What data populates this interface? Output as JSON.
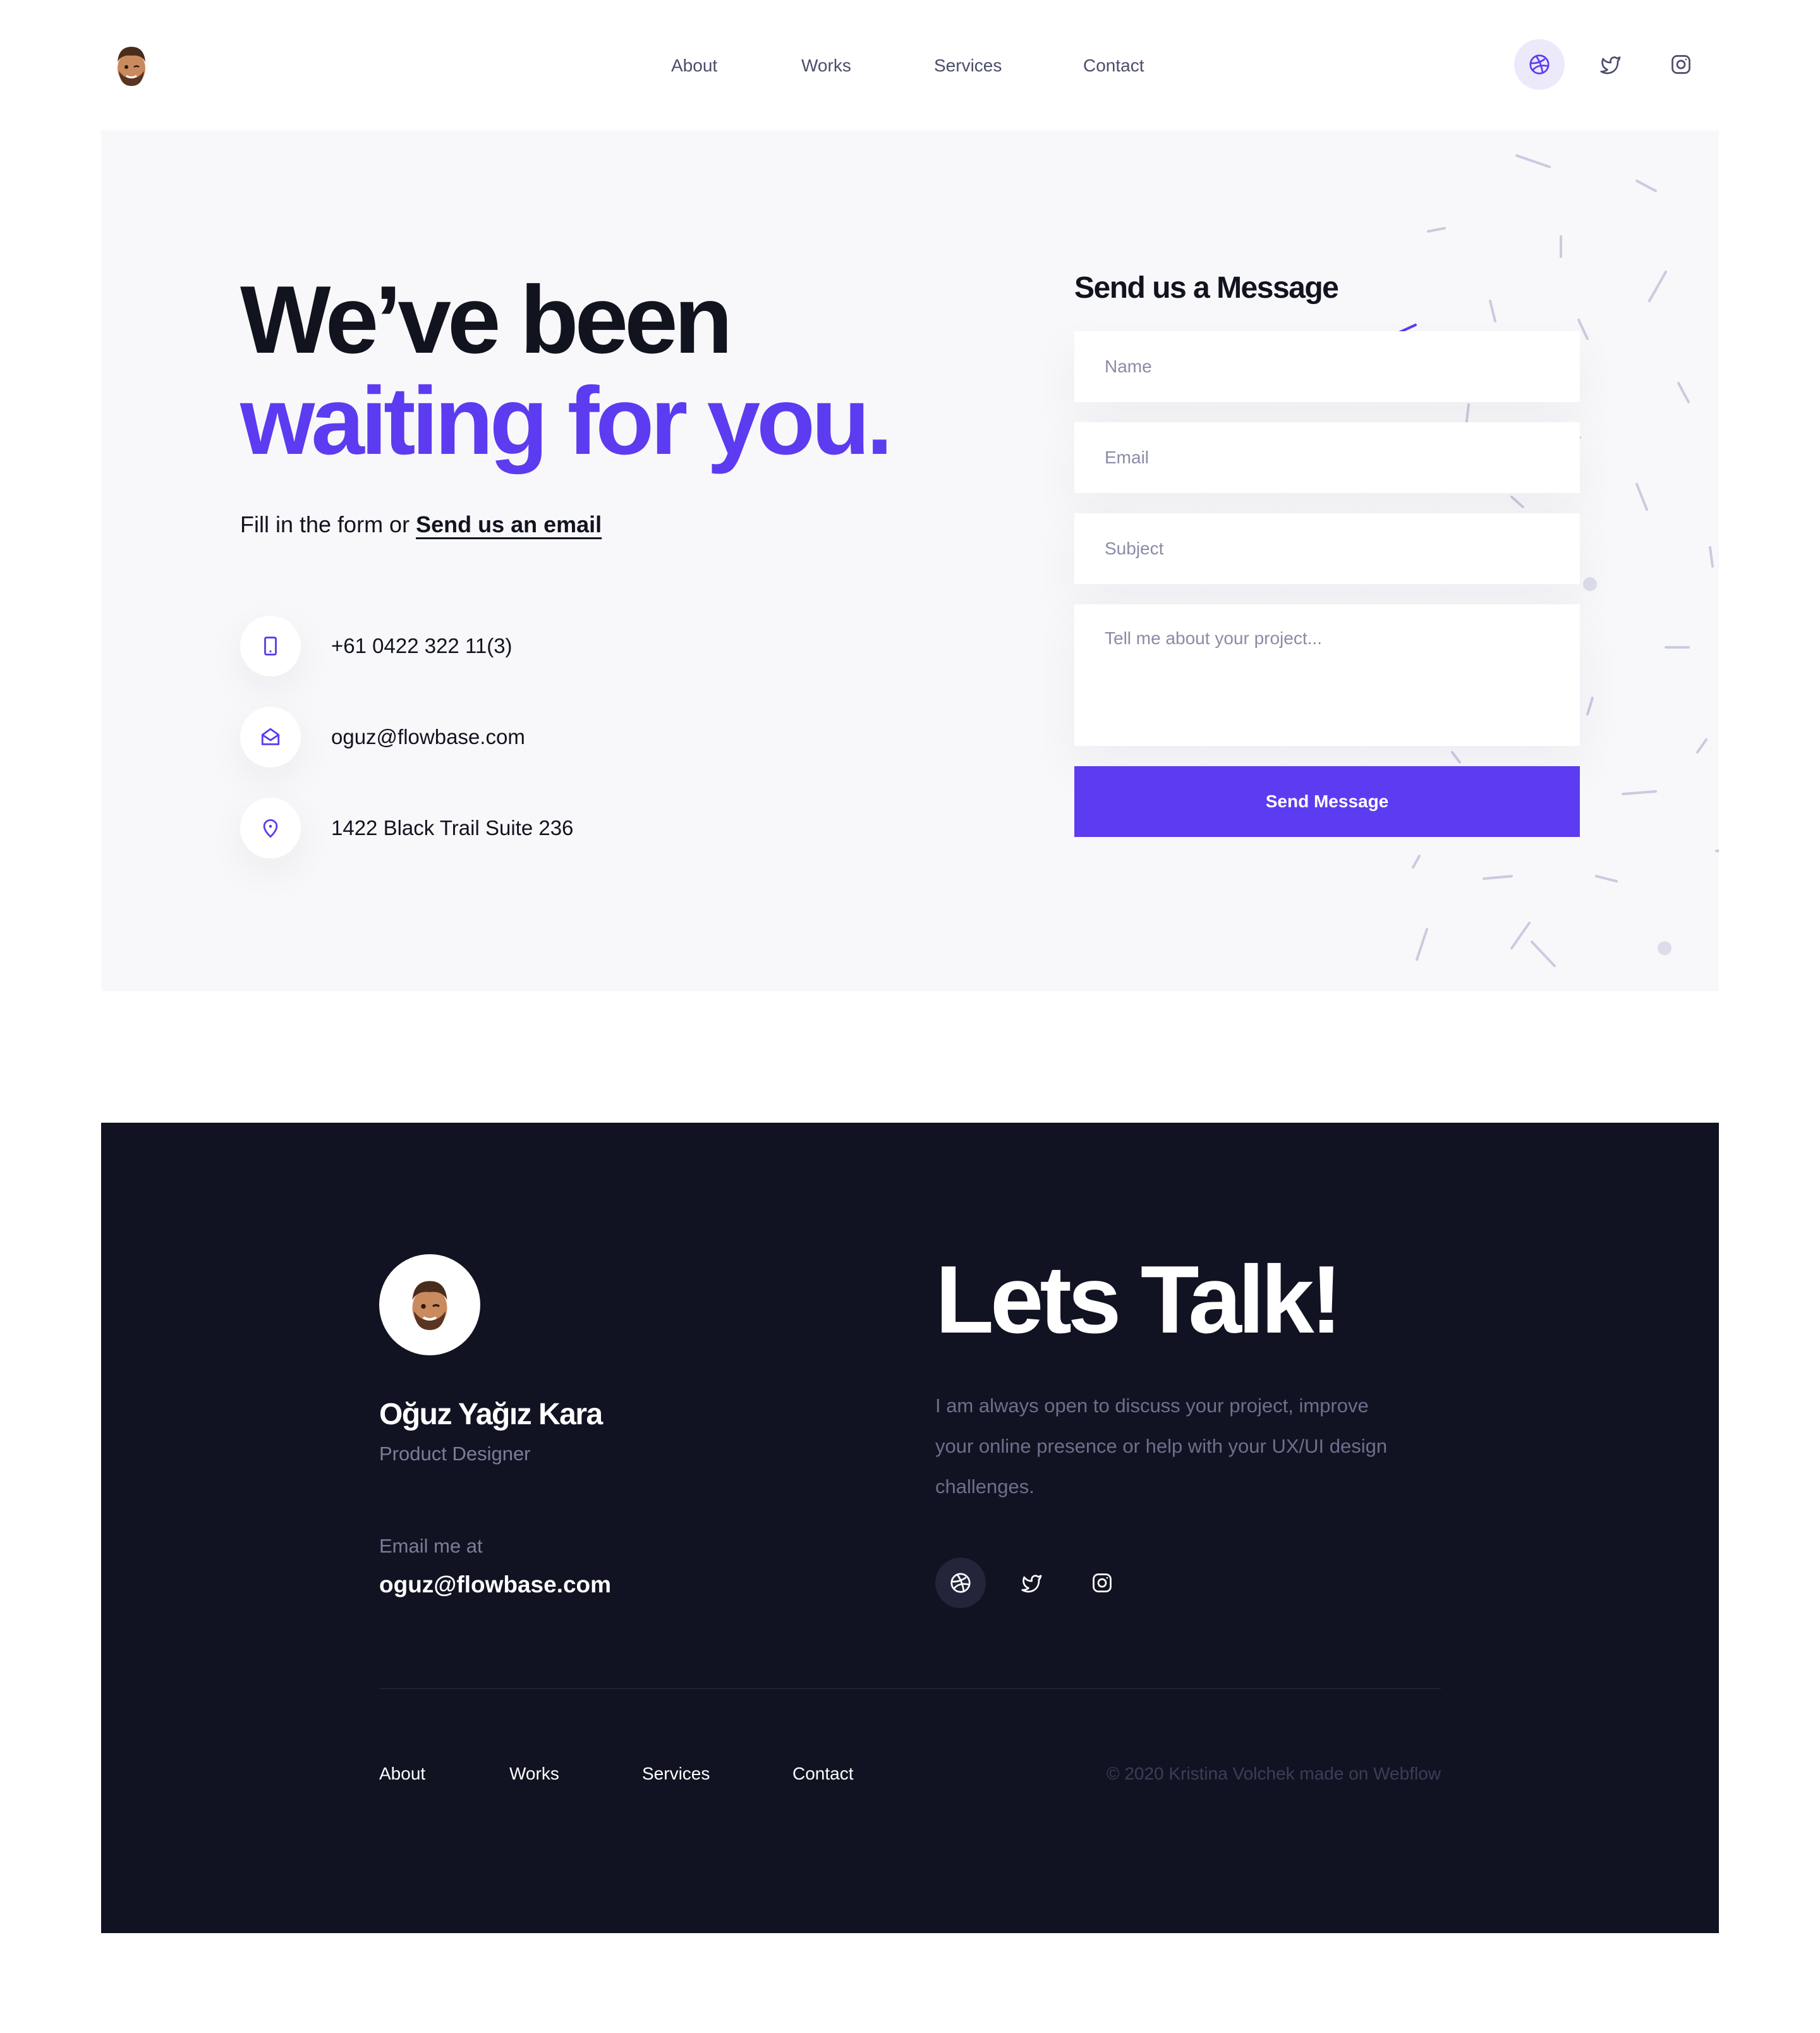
{
  "colors": {
    "accent": "#5d3bf0",
    "dark": "#11131f",
    "section_bg": "#f8f8fa",
    "footer_bg": "#111322",
    "muted": "#7b7d99"
  },
  "nav": {
    "logo_icon": "memoji-avatar-icon",
    "links": [
      "About",
      "Works",
      "Services",
      "Contact"
    ],
    "social": [
      {
        "icon": "dribbble-icon",
        "active": true
      },
      {
        "icon": "twitter-icon",
        "active": false
      },
      {
        "icon": "instagram-icon",
        "active": false
      }
    ]
  },
  "hero": {
    "headline_line1": "We’ve been",
    "headline_line2": "waiting for you.",
    "lead_text": "Fill in the form or ",
    "lead_link": "Send us an email"
  },
  "contact_info": [
    {
      "icon": "phone-icon",
      "text": "+61 0422 322 11(3)"
    },
    {
      "icon": "mail-icon",
      "text": "oguz@flowbase.com"
    },
    {
      "icon": "location-pin-icon",
      "text": "1422 Black Trail Suite 236"
    }
  ],
  "form": {
    "title": "Send us a Message",
    "name_placeholder": "Name",
    "email_placeholder": "Email",
    "subject_placeholder": "Subject",
    "message_placeholder": "Tell me about your project...",
    "name_value": "",
    "email_value": "",
    "subject_value": "",
    "message_value": "",
    "submit_label": "Send Message"
  },
  "footer": {
    "avatar_icon": "memoji-avatar-icon",
    "name": "Oğuz Yağız Kara",
    "role": "Product Designer",
    "email_label": "Email me at",
    "email": "oguz@flowbase.com",
    "title": "Lets Talk!",
    "description": "I am always open to discuss your project, improve your online presence or help with your UX/UI design challenges.",
    "social": [
      {
        "icon": "dribbble-icon",
        "active": true
      },
      {
        "icon": "twitter-icon",
        "active": false
      },
      {
        "icon": "instagram-icon",
        "active": false
      }
    ],
    "links": [
      "About",
      "Works",
      "Services",
      "Contact"
    ],
    "copyright": "© 2020 Kristina Volchek made on Webflow"
  }
}
